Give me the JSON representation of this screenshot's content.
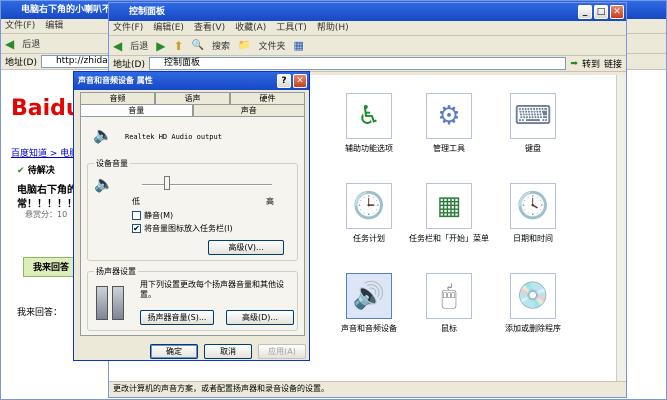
{
  "bg_window": {
    "title": "电脑右下角的小喇叭不见",
    "menu": [
      "文件(F)",
      "编辑"
    ],
    "back": "后退",
    "address_label": "地址(D)",
    "address_value": "http://zhidao.baid",
    "logo": "Baidu",
    "breadcrumb": "百度知道 > 电脑/网",
    "status": "待解决",
    "question": "电脑右下角的",
    "question2": "常！！！！！！",
    "score": "悬赏分：10",
    "answer_btn": "我来回答",
    "answer_label": "我来回答："
  },
  "cp_window": {
    "title": "控制面板",
    "menu": [
      "文件(F)",
      "编辑(E)",
      "查看(V)",
      "收藏(A)",
      "工具(T)",
      "帮助(H)"
    ],
    "back": "后退",
    "search": "搜索",
    "folders": "文件夹",
    "address_label": "地址(D)",
    "address_value": "控制面板",
    "go": "转到",
    "links": "链接",
    "status": "更改计算机的声音方案，或者配置扬声器和录音设备的设置。",
    "icons": [
      {
        "label": "辅助功能选项",
        "glyph": "♿",
        "color": "#1e8c2e"
      },
      {
        "label": "管理工具",
        "glyph": "⚙",
        "color": "#5a7bbf"
      },
      {
        "label": "键盘",
        "glyph": "⌨",
        "color": "#6f7f99"
      },
      {
        "label": "任务计划",
        "glyph": "🕒",
        "color": "#c9a227"
      },
      {
        "label": "任务栏和「开始」菜单",
        "glyph": "▦",
        "color": "#2c7a3a"
      },
      {
        "label": "日期和时间",
        "glyph": "🕓",
        "color": "#c0392b"
      },
      {
        "label": "声音和音频设备",
        "glyph": "🔊",
        "color": "#555"
      },
      {
        "label": "鼠标",
        "glyph": "🖱",
        "color": "#777"
      },
      {
        "label": "添加或删除程序",
        "glyph": "💿",
        "color": "#2a7fb8"
      }
    ]
  },
  "dialog": {
    "title": "声音和音频设备 属性",
    "tabs_row1": [
      "音频",
      "语声",
      "硬件"
    ],
    "tabs_row2": [
      "音量",
      "声音"
    ],
    "device": "Realtek HD Audio output",
    "volume_group": "设备音量",
    "low": "低",
    "high": "高",
    "mute": "静音(M)",
    "mute_checked": false,
    "tray": "将音量图标放入任务栏(I)",
    "tray_checked": true,
    "advanced1": "高级(V)...",
    "speaker_group": "扬声器设置",
    "speaker_text": "用下列设置更改每个扬声器音量和其他设置。",
    "speaker_vol": "扬声器音量(S)...",
    "advanced2": "高级(D)...",
    "ok": "确定",
    "cancel": "取消",
    "apply": "应用(A)",
    "volume_level": 0.18
  }
}
